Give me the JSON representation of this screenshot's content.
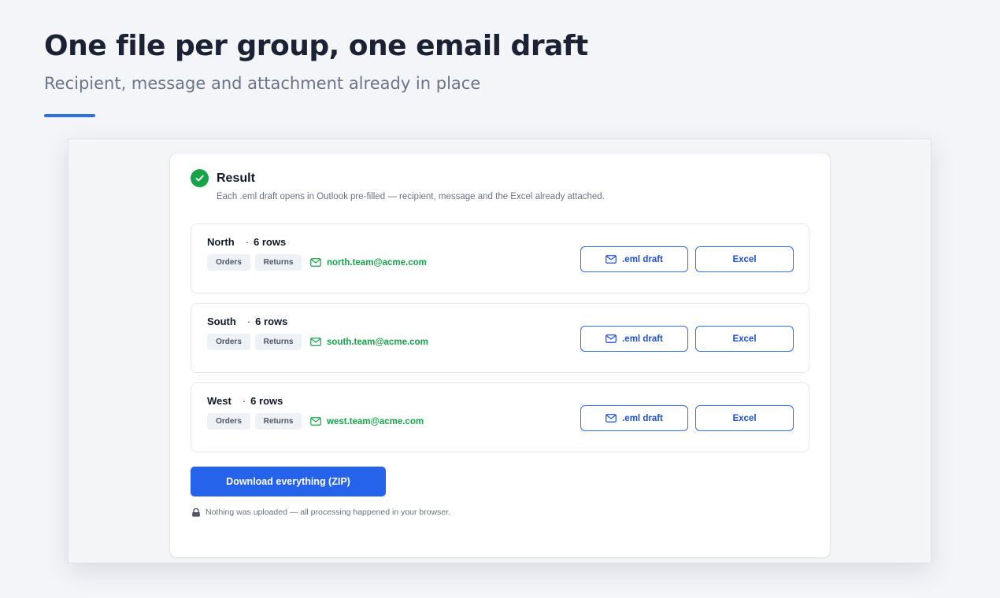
{
  "hero": {
    "title": "One file per group, one email draft",
    "subtitle": "Recipient, message and attachment already in place"
  },
  "result": {
    "title": "Result",
    "description": "Each .eml draft opens in Outlook pre-filled — recipient, message and the Excel already attached.",
    "groups": [
      {
        "name": "North",
        "separator": "·",
        "rows": "6 rows",
        "sheets": [
          "Orders",
          "Returns"
        ],
        "email": "north.team@acme.com",
        "eml_label": ".eml draft",
        "excel_label": "Excel"
      },
      {
        "name": "South",
        "separator": "·",
        "rows": "6 rows",
        "sheets": [
          "Orders",
          "Returns"
        ],
        "email": "south.team@acme.com",
        "eml_label": ".eml draft",
        "excel_label": "Excel"
      },
      {
        "name": "West",
        "separator": "·",
        "rows": "6 rows",
        "sheets": [
          "Orders",
          "Returns"
        ],
        "email": "west.team@acme.com",
        "eml_label": ".eml draft",
        "excel_label": "Excel"
      }
    ],
    "zip_label": "Download everything (ZIP)",
    "privacy_note": "Nothing was uploaded — all processing happened in your browser."
  },
  "icons": {
    "check": "check-circle-icon",
    "mail": "mail-icon",
    "lock": "lock-icon"
  },
  "colors": {
    "accent": "#2f6fe0",
    "primary_button": "#2563eb",
    "success": "#17a34a",
    "email_text": "#16a34a"
  }
}
